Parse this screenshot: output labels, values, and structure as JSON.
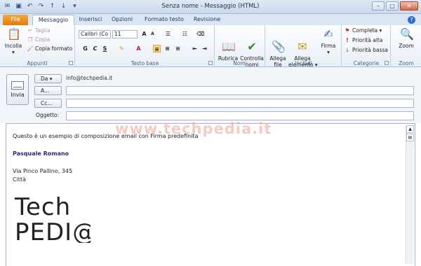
{
  "window": {
    "title": "Senza nome - Messaggio (HTML)",
    "controls": [
      "–",
      "▢",
      "✕"
    ]
  },
  "tabs": [
    "File",
    "Messaggio",
    "Inserisci",
    "Opzioni",
    "Formato testo",
    "Revisione"
  ],
  "ribbon": {
    "appunti": {
      "label": "Appunti",
      "incolla": "Incolla",
      "taglia": "Taglia",
      "copia": "Copia",
      "copia_formato": "Copia formato"
    },
    "testo_base": {
      "label": "Testo base",
      "font": "Calibri (Co",
      "size": "11"
    },
    "nomi": {
      "label": "Nomi",
      "rubrica": "Rubrica",
      "controlla": "Controlla\nnomi"
    },
    "includi": {
      "label": "Includi",
      "allega_file": "Allega\nfile",
      "allega_elemento": "Allega\nelemento",
      "firma": "Firma"
    },
    "categorie": {
      "label": "Categorie",
      "completa": "Completa",
      "priorita_alta": "Priorità alta",
      "priorita_bassa": "Priorità bassa"
    },
    "zoom": {
      "label": "Zoom",
      "zoom_btn": "Zoom"
    }
  },
  "header": {
    "send_label": "Invia",
    "from_btn": "Da",
    "from_value": "info@techpedia.it",
    "to_btn": "A...",
    "cc_btn": "Cc...",
    "subject_label": "Oggetto:"
  },
  "body": {
    "line1": "Questo è un esempio di composizione email con Firma predefinita",
    "name": "Pasquale Romano",
    "address": "Via Pinco Pallino, 345",
    "city": "Città",
    "logo_text_1": "Tech",
    "logo_text_2": "PEDI@"
  },
  "watermark": "www.techpedia.it"
}
